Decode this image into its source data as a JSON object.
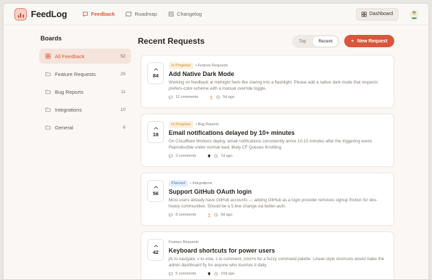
{
  "app": {
    "name": "FeedLog"
  },
  "nav": [
    {
      "label": "Feedback",
      "icon": "message-icon",
      "active": true
    },
    {
      "label": "Roadmap",
      "icon": "map-icon",
      "active": false
    },
    {
      "label": "Changelog",
      "icon": "list-icon",
      "active": false
    }
  ],
  "header": {
    "dashboard_label": "Dashboard"
  },
  "sidebar": {
    "title": "Boards",
    "items": [
      {
        "label": "All Feedback",
        "count": "52",
        "icon": "grid-icon"
      },
      {
        "label": "Feature Requests",
        "count": "25",
        "icon": "folder-icon"
      },
      {
        "label": "Bug Reports",
        "count": "11",
        "icon": "folder-icon"
      },
      {
        "label": "Integrations",
        "count": "10",
        "icon": "folder-icon"
      },
      {
        "label": "General",
        "count": "6",
        "icon": "folder-icon"
      }
    ]
  },
  "main": {
    "title": "Recent Requests",
    "sort": [
      "Top",
      "Recent"
    ],
    "new_button": "New Request",
    "cards": [
      {
        "votes": "84",
        "status": "In Progress",
        "category": "• Feature Requests",
        "title": "Add Native Dark Mode",
        "description": "Working on feedback at midnight feels like staring into a flashlight. Please add a native dark mode that respects prefers-color-scheme with a manual override toggle.",
        "comments": "12 comments",
        "time": "5d ago"
      },
      {
        "votes": "18",
        "status": "In Progress",
        "category": "• Bug Reports",
        "title": "Email notifications delayed by 10+ minutes",
        "description": "On Cloudflare Workers deploy, email notifications consistently arrive 10-15 minutes after the triggering event. Reproducible under normal load, likely CF Queues throttling.",
        "comments": "3 comments",
        "time": "7d ago"
      },
      {
        "votes": "56",
        "status": "Planned",
        "category": "• Integrations",
        "title": "Support GitHub OAuth login",
        "description": "Most users already have GitHub accounts — adding GitHub as a login provider removes signup friction for dev-heavy communities. Should be a 5-line change via better-auth.",
        "comments": "8 comments",
        "time": "9d ago"
      },
      {
        "votes": "42",
        "status": "",
        "category": "Feature Requests",
        "title": "Keyboard shortcuts for power users",
        "description": "j/k to navigate, v to vote, c to comment, cmd+k for a fuzzy command palette. Linear-style shortcuts would make the admin dashboard fly for anyone who touches it daily.",
        "comments": "5 comments",
        "time": "10d ago"
      }
    ]
  }
}
